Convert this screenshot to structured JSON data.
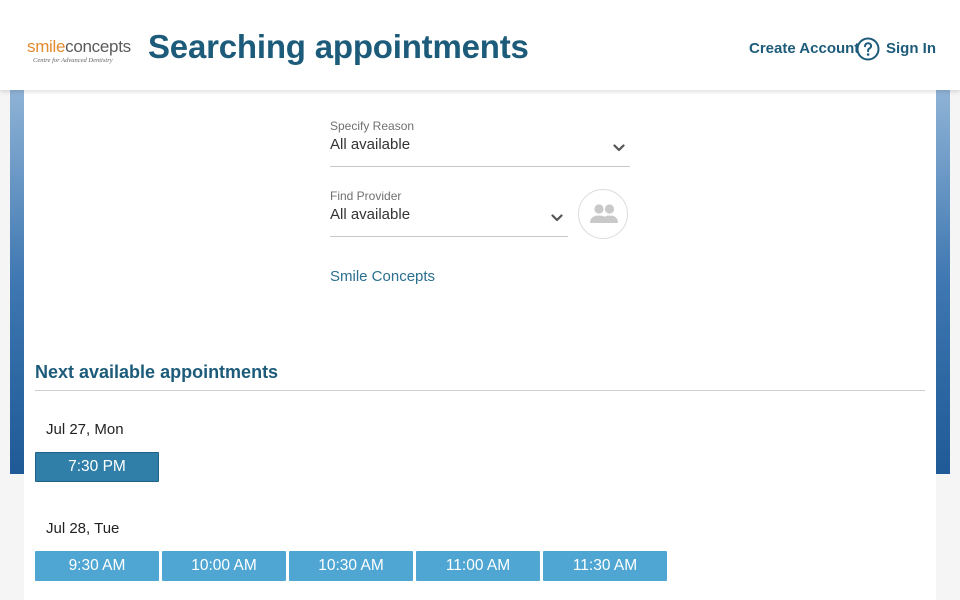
{
  "header": {
    "logo_word_1": "smile",
    "logo_word_2": "concepts",
    "logo_tagline": "Centre for Advanced Dentistry",
    "title": "Searching appointments",
    "create_account": "Create Account",
    "sign_in": "Sign In",
    "help_icon": "question-circle-icon"
  },
  "filters": {
    "reason": {
      "label": "Specify Reason",
      "value": "All available"
    },
    "provider": {
      "label": "Find Provider",
      "value": "All available",
      "icon": "people-icon"
    },
    "practice_link": "Smile Concepts"
  },
  "appointments": {
    "title": "Next available appointments",
    "days": [
      {
        "label": "Jul 27, Mon",
        "slots": [
          "7:30 PM"
        ]
      },
      {
        "label": "Jul 28, Tue",
        "slots": [
          "9:30 AM",
          "10:00 AM",
          "10:30 AM",
          "11:00 AM",
          "11:30 AM"
        ]
      }
    ]
  },
  "colors": {
    "brand_dark": "#1d5b7a",
    "slot": "#4fa6d3",
    "slot_selected": "#2f7fa8",
    "logo_orange": "#e48a2f"
  }
}
